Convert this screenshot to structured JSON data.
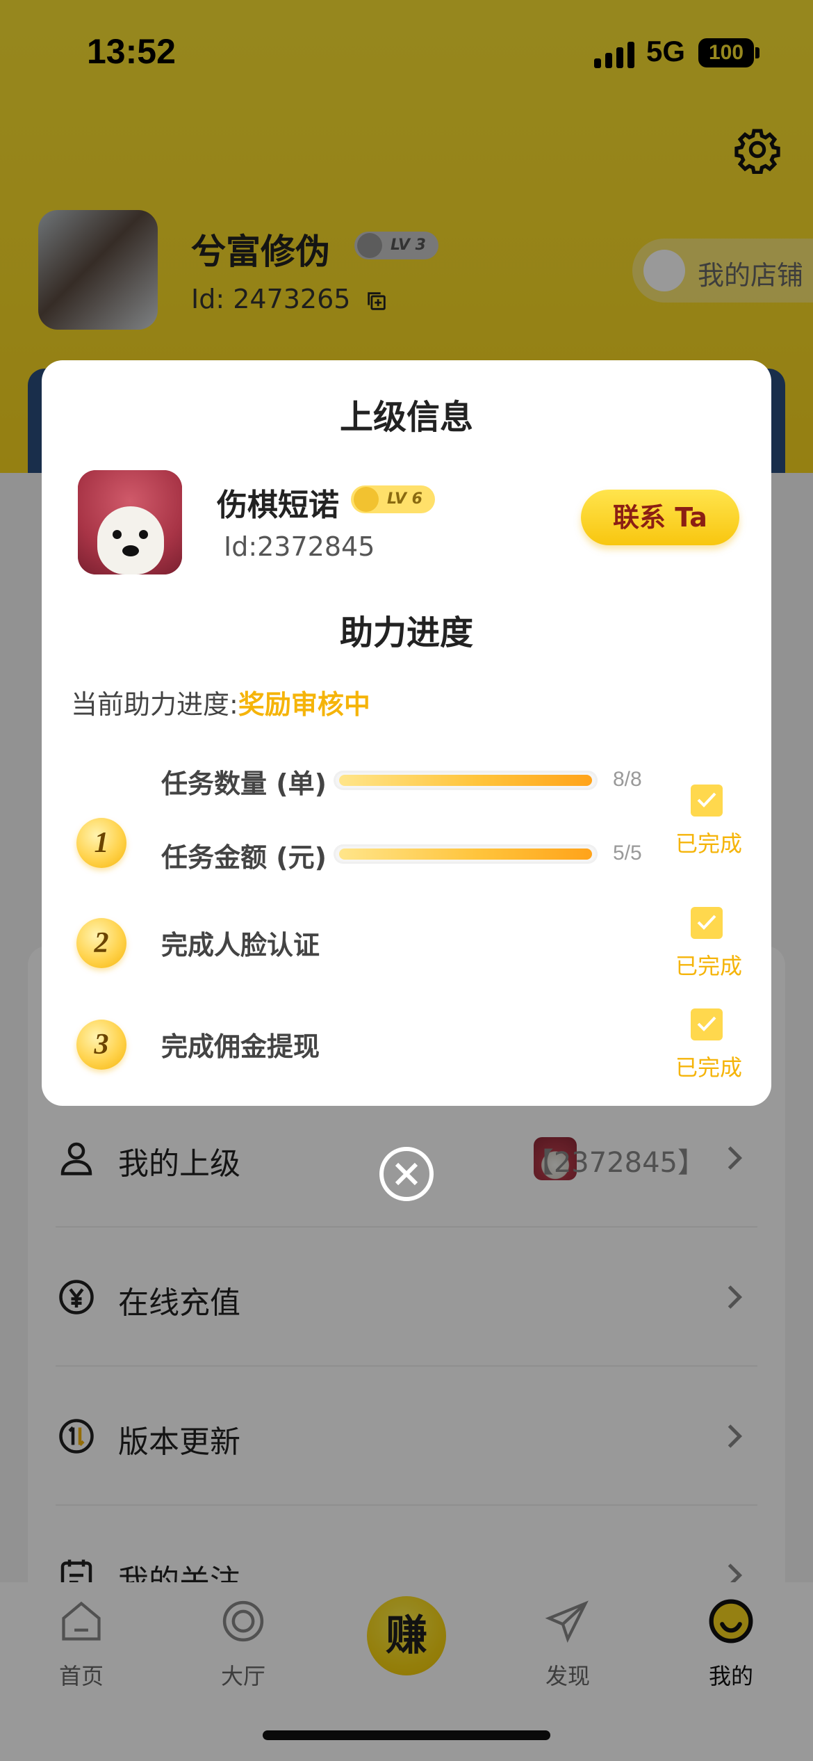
{
  "status_bar": {
    "time": "13:52",
    "network": "5G",
    "battery": "100"
  },
  "profile": {
    "name": "兮富修伪",
    "level": "LV 3",
    "id": "Id: 2473265",
    "shop_label": "我的店铺"
  },
  "menu": {
    "items": [
      {
        "label": "我的上级",
        "value": "【2372845】"
      },
      {
        "label": "在线充值"
      },
      {
        "label": "版本更新"
      },
      {
        "label": "我的关注"
      }
    ]
  },
  "tab_bar": {
    "tabs": [
      {
        "label": "首页",
        "icon": "home-icon"
      },
      {
        "label": "大厅",
        "icon": "target-icon"
      },
      {
        "label": "发现",
        "icon": "paper-plane-icon"
      },
      {
        "label": "我的",
        "icon": "smiley-icon"
      }
    ],
    "earn_label": "赚"
  },
  "modal": {
    "superior_title": "上级信息",
    "leader": {
      "name": "伤棋短诺",
      "level": "LV 6",
      "id": "Id:2372845",
      "contact_label": "联系 Ta"
    },
    "progress_title": "助力进度",
    "progress_prefix": "当前助力进度:",
    "progress_status": "奖励审核中",
    "steps": [
      {
        "number": "1",
        "tasks": [
          {
            "label": "任务数量 (单)",
            "count": "8/8",
            "progress": 1.0
          },
          {
            "label": "任务金额 (元)",
            "count": "5/5",
            "progress": 1.0
          }
        ],
        "status": "已完成"
      },
      {
        "number": "2",
        "label": "完成人脸认证",
        "status": "已完成"
      },
      {
        "number": "3",
        "label": "完成佣金提现",
        "status": "已完成"
      }
    ]
  },
  "colors": {
    "accent_yellow": "#f8d51f",
    "done_orange": "#f5b40a",
    "contact_text": "#8b1f14"
  }
}
